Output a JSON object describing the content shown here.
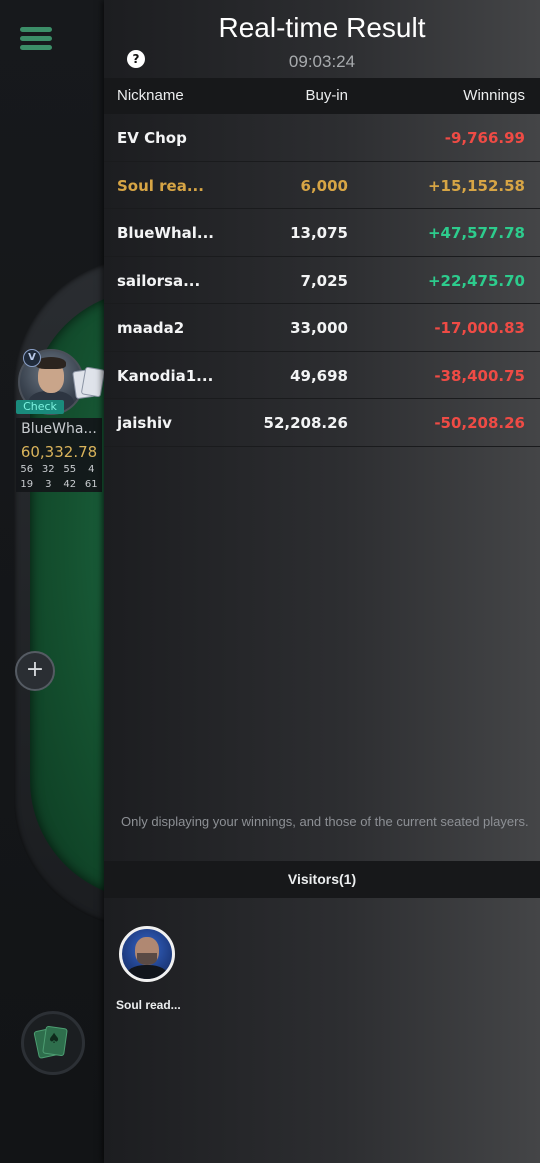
{
  "table": {
    "player": {
      "name": "BlueWha...",
      "action": "Check",
      "stack": "60,332.78",
      "stats": [
        "56",
        "32",
        "55",
        "4",
        "19",
        "3",
        "42",
        "61"
      ]
    }
  },
  "panel": {
    "title": "Real-time Result",
    "time": "09:03:24",
    "help_glyph": "?",
    "columns": {
      "nickname": "Nickname",
      "buyin": "Buy-in",
      "winnings": "Winnings"
    },
    "rows": [
      {
        "nickname": "EV Chop",
        "buyin": "",
        "winnings": "-9,766.99",
        "tone": "neg"
      },
      {
        "nickname": "Soul rea...",
        "buyin": "6,000",
        "winnings": "+15,152.58",
        "tone": "me"
      },
      {
        "nickname": "BlueWhal...",
        "buyin": "13,075",
        "winnings": "+47,577.78",
        "tone": "pos"
      },
      {
        "nickname": "sailorsa...",
        "buyin": "7,025",
        "winnings": "+22,475.70",
        "tone": "pos"
      },
      {
        "nickname": "maada2",
        "buyin": "33,000",
        "winnings": "-17,000.83",
        "tone": "neg"
      },
      {
        "nickname": "Kanodia1...",
        "buyin": "49,698",
        "winnings": "-38,400.75",
        "tone": "neg"
      },
      {
        "nickname": "jaishiv",
        "buyin": "52,208.26",
        "winnings": "-50,208.26",
        "tone": "neg"
      }
    ],
    "note": "Only displaying your winnings, and those of the current seated players.",
    "visitors_label": "Visitors(1)",
    "visitors": [
      {
        "name": "Soul read..."
      }
    ]
  },
  "colors": {
    "negative": "#ef4b45",
    "positive": "#2dcc8d",
    "self_highlight": "#d7a545",
    "felt": "#1f6b45"
  },
  "icons": [
    "hamburger-menu-icon",
    "help-icon",
    "plus-icon",
    "cards-icon"
  ]
}
